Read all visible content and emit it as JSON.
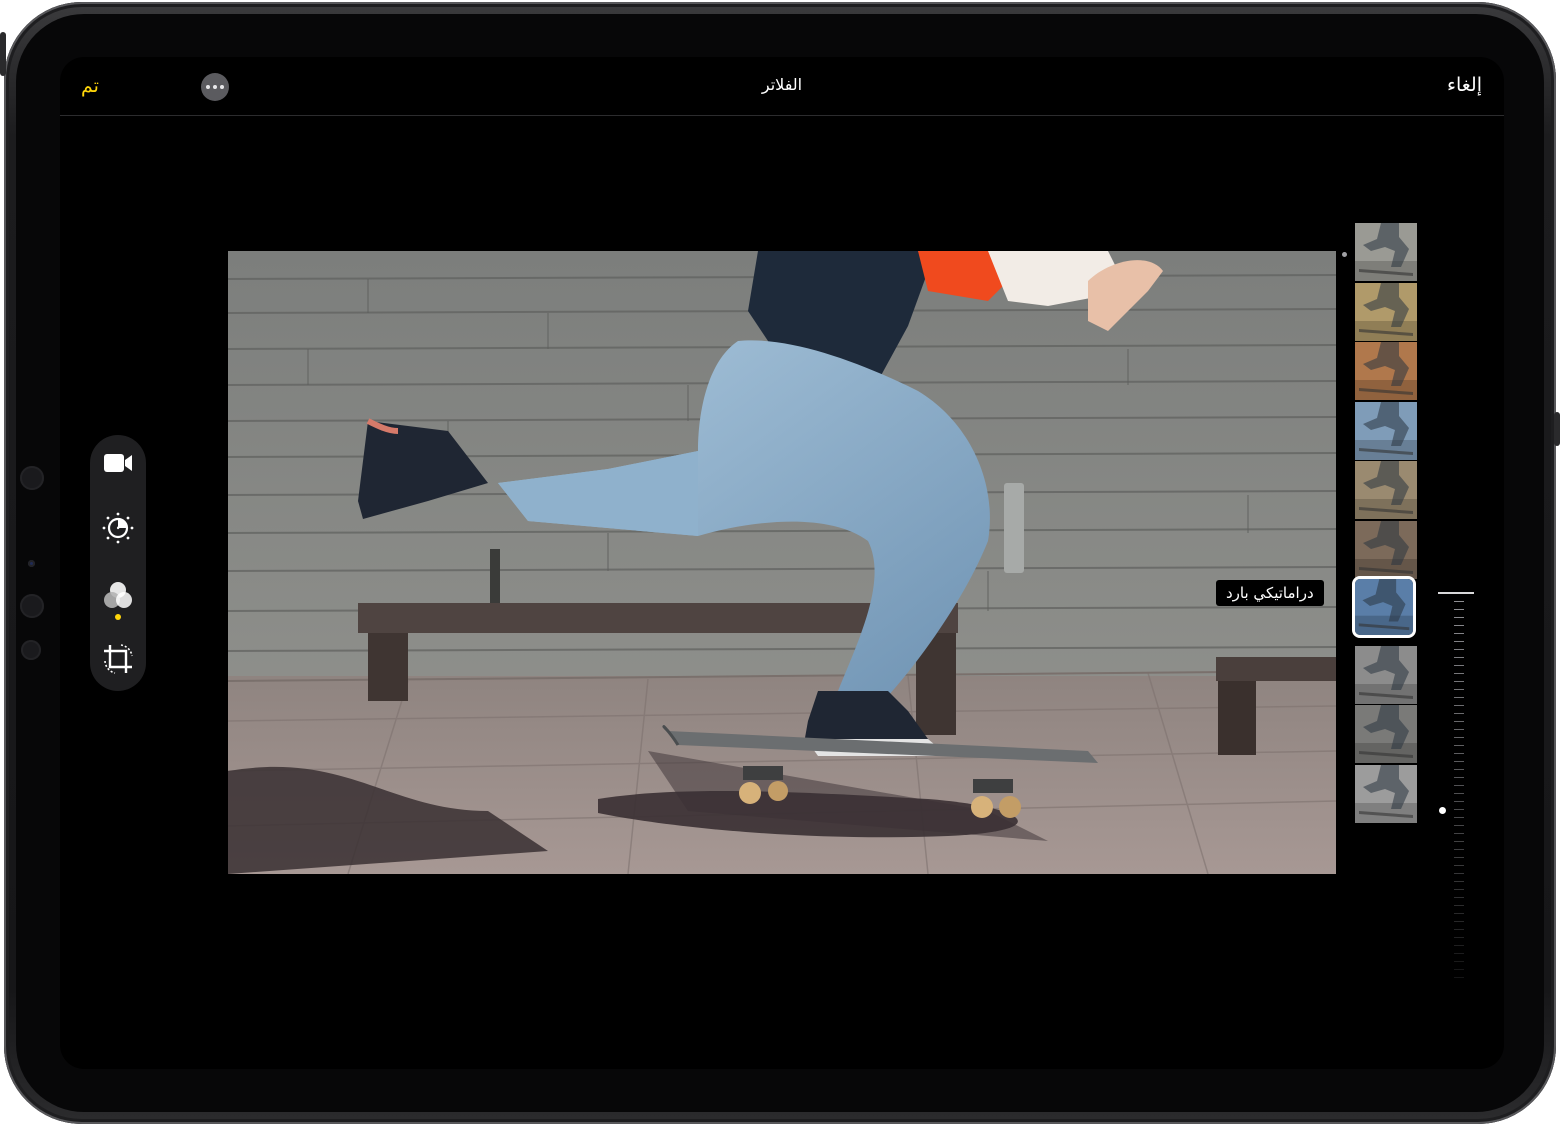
{
  "topbar": {
    "done_label": "تم",
    "title": "الفلاتر",
    "cancel_label": "إلغاء",
    "more_icon": "ellipsis-icon"
  },
  "sidebar": {
    "tools": [
      {
        "name": "video-icon"
      },
      {
        "name": "adjust-icon"
      },
      {
        "name": "filters-icon",
        "active": true
      },
      {
        "name": "crop-icon"
      }
    ]
  },
  "filters": {
    "selected_label": "دراماتيكي بارد",
    "selected_index": 6,
    "count": 10,
    "thumb_tints": [
      "#9a9a94",
      "#b09a6a",
      "#b0784c",
      "#7f9cb8",
      "#9a8a70",
      "#7c6a5a",
      "#5a7ea8",
      "#8c8c8c",
      "#7a7a78",
      "#9c9c9c"
    ]
  },
  "colors": {
    "accent": "#ffd60a",
    "background": "#000000"
  }
}
